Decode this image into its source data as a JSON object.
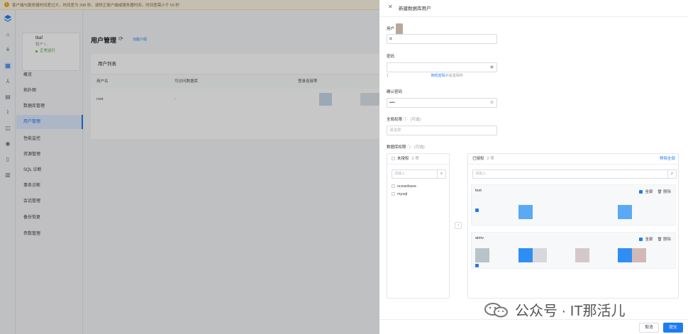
{
  "banner": {
    "text": "客户端与服务器时间差过大，时间差为 398 秒。请矫正客户端或服务器时间，时间差需小于 50 秒"
  },
  "sidebar": {
    "tenant": {
      "name": "tbaf",
      "sub": "租户 t...",
      "status": "正常运行"
    },
    "items": [
      {
        "label": "概览"
      },
      {
        "label": "拓扑图"
      },
      {
        "label": "数据库管理"
      },
      {
        "label": "用户管理"
      },
      {
        "label": "性能监控"
      },
      {
        "label": "资源管理"
      },
      {
        "label": "SQL 诊断"
      },
      {
        "label": "事务诊断"
      },
      {
        "label": "会话管理"
      },
      {
        "label": "备份恢复"
      },
      {
        "label": "参数管理"
      }
    ]
  },
  "main": {
    "title": "用户管理",
    "link": "功能介绍",
    "card_title": "用户列表",
    "columns": [
      "用户名",
      "可访问数据库",
      "登录连接等"
    ],
    "rows": [
      {
        "name": "root",
        "dbs": "-"
      }
    ]
  },
  "drawer": {
    "title": "新建数据库用户",
    "username_label": "用户",
    "username_value": "d.",
    "password_label": "密码",
    "password_hint_pre": "1",
    "password_hint_link": "随机密码",
    "password_hint_post": "并妥善保存",
    "confirm_label": "确认密码",
    "confirm_value": "••••",
    "global_label": "全局权限",
    "global_optional": "(可选)",
    "global_placeholder": "请选择",
    "dbperm_label": "数据库权限",
    "dbperm_optional": "(可选)",
    "unauth": {
      "title": "未授权",
      "count": "2 项",
      "search_placeholder": "请输入",
      "items": [
        "oceanbase",
        "mysql"
      ]
    },
    "auth": {
      "title": "已授权",
      "count": "2 项",
      "remove_all": "移除全部",
      "search_placeholder": "请输入",
      "groups": [
        {
          "name": "test",
          "all_label": "全部",
          "delete_label": "删除"
        },
        {
          "name": "atmv",
          "all_label": "全部",
          "delete_label": "删除"
        }
      ]
    },
    "cancel": "取消",
    "submit": "提交"
  },
  "watermark": "公众号 · IT那活儿",
  "colors": {
    "primary": "#1f7cf0",
    "swatch_gray": "#b8c4c8",
    "swatch_pink": "#d5c8c8"
  }
}
